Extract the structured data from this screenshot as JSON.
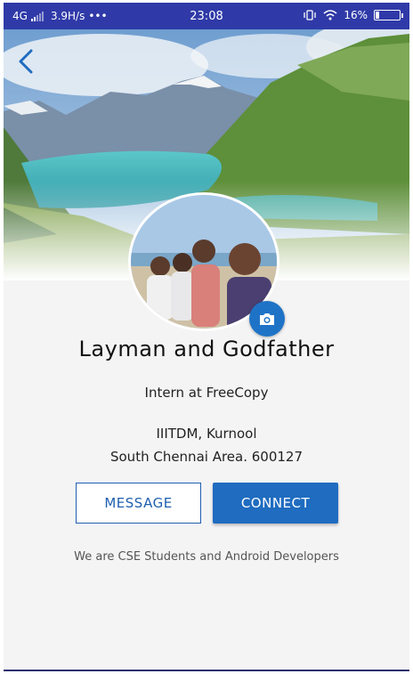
{
  "status_bar": {
    "network": "4G",
    "speed": "3.9H/s",
    "dots": "•••",
    "time": "23:08",
    "battery_percent": "16%",
    "battery_level": 0.16,
    "color": "#2f3aa8"
  },
  "header": {
    "back_icon": "chevron-left-icon"
  },
  "profile": {
    "name": "Layman and Godfather",
    "headline": "Intern at FreeCopy",
    "location_line1": "IIITDM, Kurnool",
    "location_line2": "South Chennai Area. 600127",
    "camera_icon": "camera-icon"
  },
  "actions": {
    "message_label": "MESSAGE",
    "connect_label": "CONNECT"
  },
  "bio": "We are CSE Students and Android Developers",
  "colors": {
    "accent": "#1f6cc0",
    "status_bar": "#2f3aa8",
    "content_bg": "#f4f4f5"
  }
}
